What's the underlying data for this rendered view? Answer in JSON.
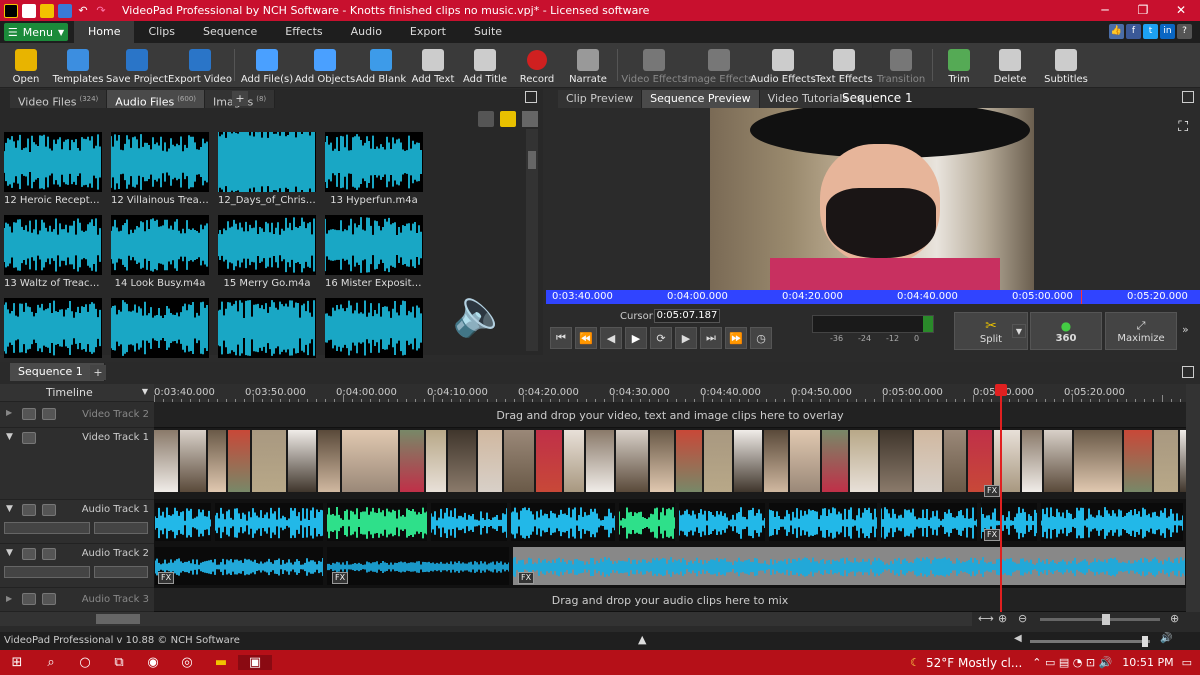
{
  "window": {
    "title": "VideoPad Professional by NCH Software - Knotts finished clips no music.vpj* - Licensed software"
  },
  "menu": {
    "button": "Menu",
    "tabs": [
      "Home",
      "Clips",
      "Sequence",
      "Effects",
      "Audio",
      "Export",
      "Suite"
    ],
    "active": "Home"
  },
  "toolbar": {
    "items": [
      {
        "label": "Open",
        "icon": "folder-icon",
        "color": "#e8b400",
        "enabled": true
      },
      {
        "label": "Templates",
        "icon": "templates-icon",
        "color": "#3c8ee0",
        "enabled": true
      },
      {
        "label": "Save Project",
        "icon": "save-icon",
        "color": "#2a75c8",
        "enabled": true
      },
      {
        "label": "Export Video",
        "icon": "export-icon",
        "color": "#2a75c8",
        "enabled": true
      },
      {
        "label": "Add File(s)",
        "icon": "add-file-icon",
        "color": "#4aa0ff",
        "enabled": true
      },
      {
        "label": "Add Objects",
        "icon": "add-objects-icon",
        "color": "#4aa0ff",
        "enabled": true
      },
      {
        "label": "Add Blank",
        "icon": "add-blank-icon",
        "color": "#3d9be9",
        "enabled": true
      },
      {
        "label": "Add Text",
        "icon": "add-text-icon",
        "color": "#cccccc",
        "enabled": true
      },
      {
        "label": "Add Title",
        "icon": "add-title-icon",
        "color": "#cccccc",
        "enabled": true
      },
      {
        "label": "Record",
        "icon": "record-icon",
        "color": "#d02020",
        "enabled": true
      },
      {
        "label": "Narrate",
        "icon": "microphone-icon",
        "color": "#999999",
        "enabled": true
      },
      {
        "label": "Video Effects",
        "icon": "video-effects-icon",
        "color": "#777777",
        "enabled": false
      },
      {
        "label": "Image Effects",
        "icon": "image-effects-icon",
        "color": "#777777",
        "enabled": false
      },
      {
        "label": "Audio Effects",
        "icon": "audio-effects-icon",
        "color": "#cccccc",
        "enabled": true
      },
      {
        "label": "Text Effects",
        "icon": "text-effects-icon",
        "color": "#cccccc",
        "enabled": true
      },
      {
        "label": "Transition",
        "icon": "transition-icon",
        "color": "#777777",
        "enabled": false
      },
      {
        "label": "Trim",
        "icon": "trim-icon",
        "color": "#55aa55",
        "enabled": true
      },
      {
        "label": "Delete",
        "icon": "trash-icon",
        "color": "#cccccc",
        "enabled": true
      },
      {
        "label": "Subtitles",
        "icon": "subtitles-icon",
        "color": "#cccccc",
        "enabled": true
      }
    ]
  },
  "bins": {
    "tabs": [
      {
        "label": "Video Files",
        "count": "(324)"
      },
      {
        "label": "Audio Files",
        "count": "(600)"
      },
      {
        "label": "Images",
        "count": "(8)"
      }
    ],
    "active": "Audio Files",
    "files": [
      "12 Heroic Reception....",
      "12 Villainous Treache...",
      "12_Days_of_Christm...",
      "13 Hyperfun.m4a",
      "13 Waltz of Treache...",
      "14 Look Busy.m4a",
      "15 Merry Go.m4a",
      "16 Mister Exposition....",
      "",
      "",
      "",
      ""
    ]
  },
  "preview": {
    "tabs": [
      "Clip Preview",
      "Sequence Preview",
      "Video Tutorials"
    ],
    "active": "Sequence Preview",
    "title": "Sequence 1",
    "ruler": [
      "0:03:40.000",
      "0:04:00.000",
      "0:04:20.000",
      "0:04:40.000",
      "0:05:00.000",
      "0:05:20.000"
    ],
    "cursor_label": "Cursor:",
    "cursor_value": "0:05:07.187",
    "meter": [
      "-36",
      "-24",
      "-12",
      "0"
    ],
    "split": "Split",
    "btn360": "360",
    "maximize": "Maximize"
  },
  "sequence": {
    "tab": "Sequence 1",
    "timeline_label": "Timeline",
    "ruler": [
      "0:03:40.000",
      "0:03:50.000",
      "0:04:00.000",
      "0:04:10.000",
      "0:04:20.000",
      "0:04:30.000",
      "0:04:40.000",
      "0:04:50.000",
      "0:05:00.000",
      "0:05:10.000",
      "0:05:20.000"
    ],
    "tracks": {
      "video2": "Video Track 2",
      "video1": "Video Track 1",
      "audio1": "Audio Track 1",
      "audio2": "Audio Track 2",
      "audio3": "Audio Track 3"
    },
    "video_hint": "Drag and drop your video, text and image clips here to overlay",
    "audio_hint": "Drag and drop your audio clips here to mix",
    "fx": "FX"
  },
  "status": {
    "text": "VideoPad Professional v 10.88 © NCH Software"
  },
  "taskbar": {
    "weather": "52°F  Mostly cl...",
    "time": "10:51 PM"
  }
}
